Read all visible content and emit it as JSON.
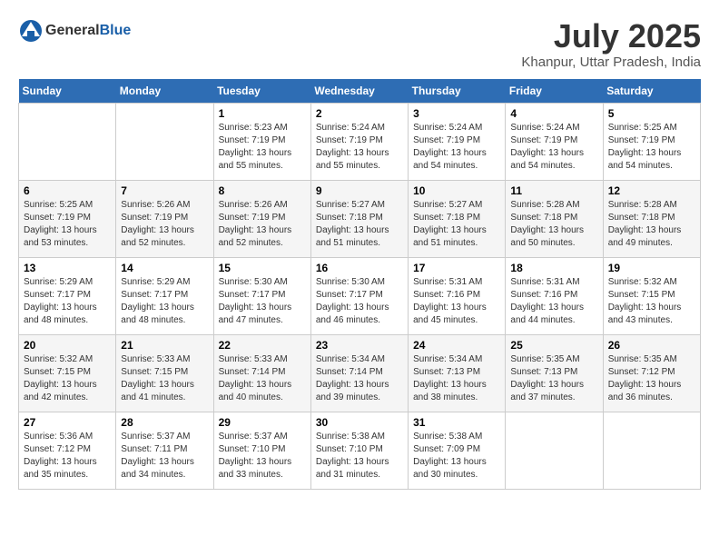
{
  "logo": {
    "general": "General",
    "blue": "Blue"
  },
  "title": {
    "month_year": "July 2025",
    "location": "Khanpur, Uttar Pradesh, India"
  },
  "headers": [
    "Sunday",
    "Monday",
    "Tuesday",
    "Wednesday",
    "Thursday",
    "Friday",
    "Saturday"
  ],
  "weeks": [
    [
      {
        "day": "",
        "info": ""
      },
      {
        "day": "",
        "info": ""
      },
      {
        "day": "1",
        "info": "Sunrise: 5:23 AM\nSunset: 7:19 PM\nDaylight: 13 hours and 55 minutes."
      },
      {
        "day": "2",
        "info": "Sunrise: 5:24 AM\nSunset: 7:19 PM\nDaylight: 13 hours and 55 minutes."
      },
      {
        "day": "3",
        "info": "Sunrise: 5:24 AM\nSunset: 7:19 PM\nDaylight: 13 hours and 54 minutes."
      },
      {
        "day": "4",
        "info": "Sunrise: 5:24 AM\nSunset: 7:19 PM\nDaylight: 13 hours and 54 minutes."
      },
      {
        "day": "5",
        "info": "Sunrise: 5:25 AM\nSunset: 7:19 PM\nDaylight: 13 hours and 54 minutes."
      }
    ],
    [
      {
        "day": "6",
        "info": "Sunrise: 5:25 AM\nSunset: 7:19 PM\nDaylight: 13 hours and 53 minutes."
      },
      {
        "day": "7",
        "info": "Sunrise: 5:26 AM\nSunset: 7:19 PM\nDaylight: 13 hours and 52 minutes."
      },
      {
        "day": "8",
        "info": "Sunrise: 5:26 AM\nSunset: 7:19 PM\nDaylight: 13 hours and 52 minutes."
      },
      {
        "day": "9",
        "info": "Sunrise: 5:27 AM\nSunset: 7:18 PM\nDaylight: 13 hours and 51 minutes."
      },
      {
        "day": "10",
        "info": "Sunrise: 5:27 AM\nSunset: 7:18 PM\nDaylight: 13 hours and 51 minutes."
      },
      {
        "day": "11",
        "info": "Sunrise: 5:28 AM\nSunset: 7:18 PM\nDaylight: 13 hours and 50 minutes."
      },
      {
        "day": "12",
        "info": "Sunrise: 5:28 AM\nSunset: 7:18 PM\nDaylight: 13 hours and 49 minutes."
      }
    ],
    [
      {
        "day": "13",
        "info": "Sunrise: 5:29 AM\nSunset: 7:17 PM\nDaylight: 13 hours and 48 minutes."
      },
      {
        "day": "14",
        "info": "Sunrise: 5:29 AM\nSunset: 7:17 PM\nDaylight: 13 hours and 48 minutes."
      },
      {
        "day": "15",
        "info": "Sunrise: 5:30 AM\nSunset: 7:17 PM\nDaylight: 13 hours and 47 minutes."
      },
      {
        "day": "16",
        "info": "Sunrise: 5:30 AM\nSunset: 7:17 PM\nDaylight: 13 hours and 46 minutes."
      },
      {
        "day": "17",
        "info": "Sunrise: 5:31 AM\nSunset: 7:16 PM\nDaylight: 13 hours and 45 minutes."
      },
      {
        "day": "18",
        "info": "Sunrise: 5:31 AM\nSunset: 7:16 PM\nDaylight: 13 hours and 44 minutes."
      },
      {
        "day": "19",
        "info": "Sunrise: 5:32 AM\nSunset: 7:15 PM\nDaylight: 13 hours and 43 minutes."
      }
    ],
    [
      {
        "day": "20",
        "info": "Sunrise: 5:32 AM\nSunset: 7:15 PM\nDaylight: 13 hours and 42 minutes."
      },
      {
        "day": "21",
        "info": "Sunrise: 5:33 AM\nSunset: 7:15 PM\nDaylight: 13 hours and 41 minutes."
      },
      {
        "day": "22",
        "info": "Sunrise: 5:33 AM\nSunset: 7:14 PM\nDaylight: 13 hours and 40 minutes."
      },
      {
        "day": "23",
        "info": "Sunrise: 5:34 AM\nSunset: 7:14 PM\nDaylight: 13 hours and 39 minutes."
      },
      {
        "day": "24",
        "info": "Sunrise: 5:34 AM\nSunset: 7:13 PM\nDaylight: 13 hours and 38 minutes."
      },
      {
        "day": "25",
        "info": "Sunrise: 5:35 AM\nSunset: 7:13 PM\nDaylight: 13 hours and 37 minutes."
      },
      {
        "day": "26",
        "info": "Sunrise: 5:35 AM\nSunset: 7:12 PM\nDaylight: 13 hours and 36 minutes."
      }
    ],
    [
      {
        "day": "27",
        "info": "Sunrise: 5:36 AM\nSunset: 7:12 PM\nDaylight: 13 hours and 35 minutes."
      },
      {
        "day": "28",
        "info": "Sunrise: 5:37 AM\nSunset: 7:11 PM\nDaylight: 13 hours and 34 minutes."
      },
      {
        "day": "29",
        "info": "Sunrise: 5:37 AM\nSunset: 7:10 PM\nDaylight: 13 hours and 33 minutes."
      },
      {
        "day": "30",
        "info": "Sunrise: 5:38 AM\nSunset: 7:10 PM\nDaylight: 13 hours and 31 minutes."
      },
      {
        "day": "31",
        "info": "Sunrise: 5:38 AM\nSunset: 7:09 PM\nDaylight: 13 hours and 30 minutes."
      },
      {
        "day": "",
        "info": ""
      },
      {
        "day": "",
        "info": ""
      }
    ]
  ]
}
